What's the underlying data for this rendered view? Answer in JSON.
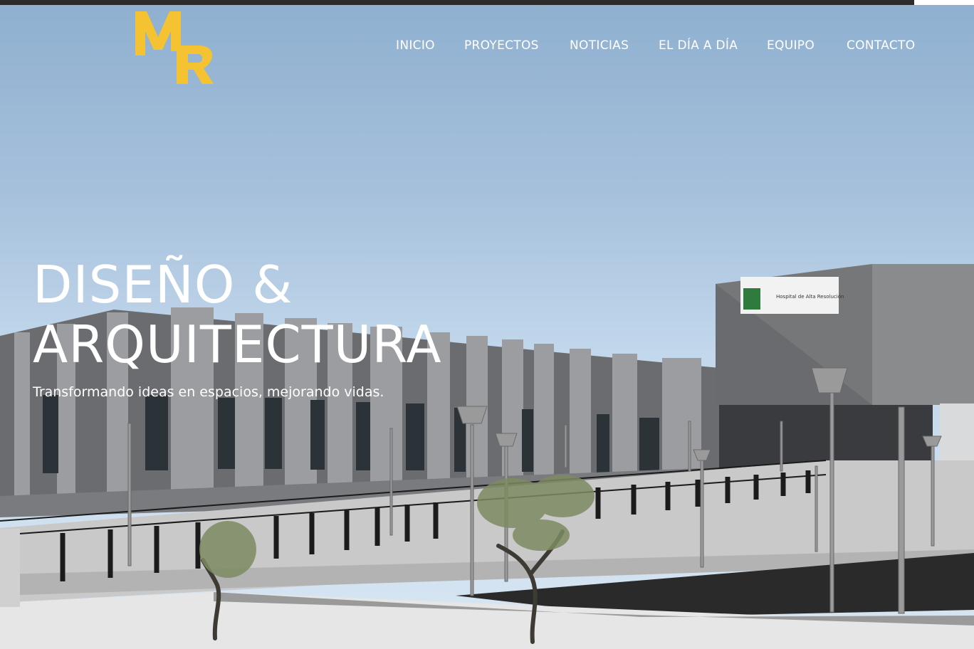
{
  "nav": {
    "items": [
      "INICIO",
      "PROYECTOS",
      "NOTICIAS",
      "EL DÍA A DÍA",
      "EQUIPO",
      "CONTACTO"
    ]
  },
  "logo": {
    "text": "MR",
    "color": "#f5c232"
  },
  "hero": {
    "title_line1": "DISEÑO &",
    "title_line2": "ARQUITECTURA",
    "subtitle": "Transformando ideas en espacios, mejorando vidas.",
    "building_sign": "Hospital de Alta Resolución"
  },
  "colors": {
    "accent": "#f5c232",
    "topbar": "#2b2b2b",
    "text": "#ffffff"
  }
}
